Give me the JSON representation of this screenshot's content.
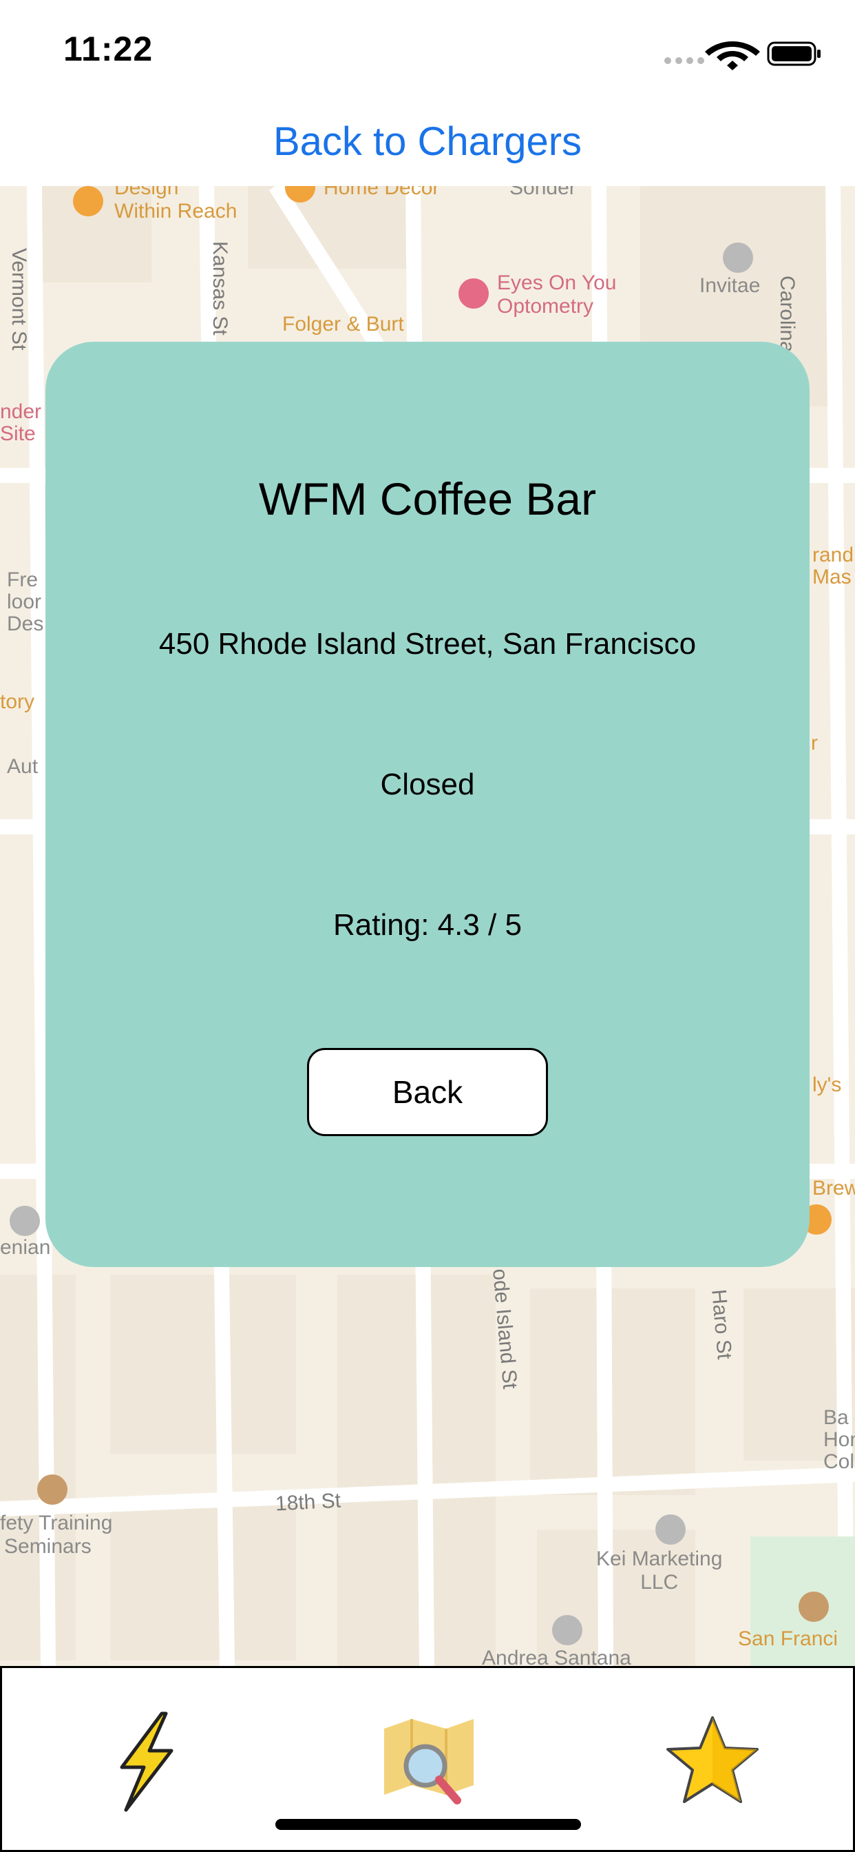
{
  "status_bar": {
    "time": "11:22"
  },
  "nav": {
    "back_label": "Back to Chargers"
  },
  "map": {
    "labels": {
      "design_within_reach": [
        "Design",
        "Within Reach"
      ],
      "home_decor": "Home Decor",
      "sonder": "Sonder",
      "carolina_st": "Carolina St",
      "vermont_st": "Vermont St",
      "kansas_st": "Kansas St",
      "eyes_on_you": [
        "Eyes On You",
        "Optometry"
      ],
      "invitae": "Invitae",
      "folger_burt": "Folger & Burt",
      "safety_training": [
        "fety Training",
        "Seminars"
      ],
      "street_18th": "18th St",
      "rhode_island_st": "ode Island St",
      "haro_st": "Haro St",
      "kei_marketing": [
        "Kei Marketing",
        "LLC"
      ],
      "andrea_santana": "Andrea Santana",
      "san_francisco": "San Franci",
      "enian": "enian",
      "left_frag_1": [
        "nder",
        "Site"
      ],
      "left_frag_2": [
        "Fre",
        "loor",
        "Des"
      ],
      "left_frag_3": "tory",
      "left_frag_4": "Aut",
      "right_frag_1": [
        "rand",
        "Mas"
      ],
      "right_frag_2": "r",
      "right_frag_3": "ly's",
      "right_frag_4": "Brew",
      "right_frag_5": [
        "Ba",
        "Hon",
        "Col"
      ]
    }
  },
  "card": {
    "title": "WFM Coffee Bar",
    "address": "450 Rhode Island Street, San Francisco",
    "status": "Closed",
    "rating": "Rating: 4.3 / 5",
    "back_label": "Back",
    "background": "#9ad5ca"
  },
  "tab_bar": {
    "tabs": [
      {
        "icon": "lightning-icon"
      },
      {
        "icon": "map-search-icon"
      },
      {
        "icon": "star-icon"
      }
    ]
  },
  "colors": {
    "accent": "#1a73e8",
    "map_background": "#f5efe3"
  }
}
